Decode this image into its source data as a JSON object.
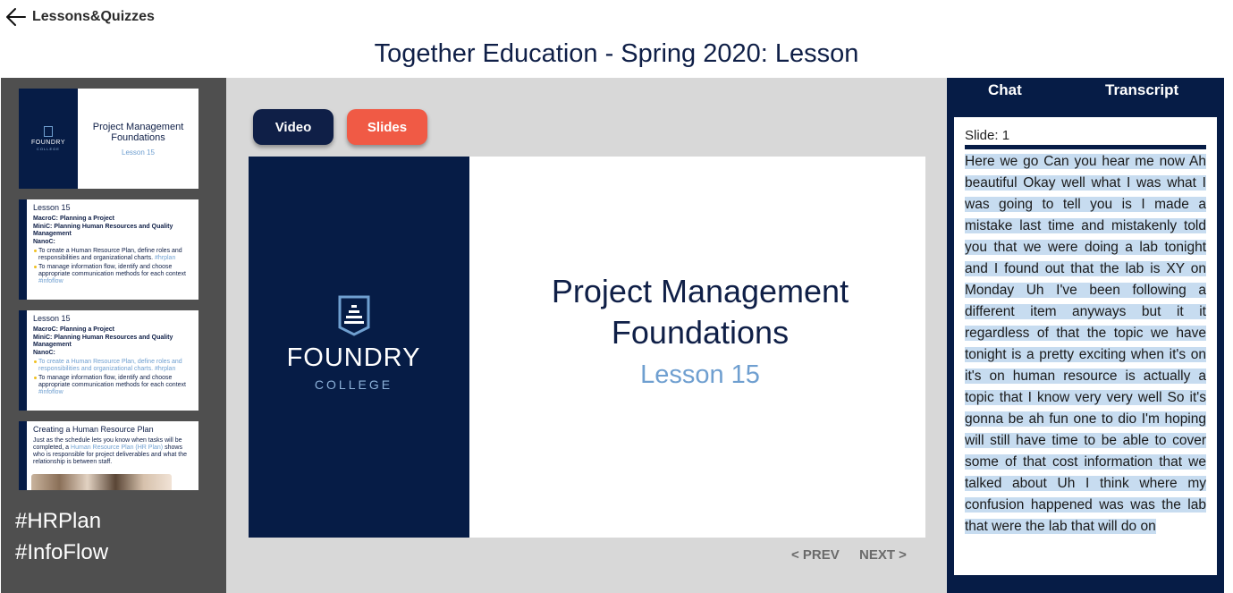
{
  "header": {
    "back_label": "Lessons&Quizzes",
    "page_title": "Together Education - Spring 2020: Lesson"
  },
  "sidebar": {
    "thumbnails": [
      {
        "brand": "FOUNDRY",
        "college": "COLLEGE",
        "title": "Project Management Foundations",
        "subtitle": "Lesson 15"
      },
      {
        "heading": "Lesson 15",
        "macro": "MacroC: Planning a Project",
        "mini": "MiniC: Planning Human Resources and Quality Management",
        "nano": "NanoC:",
        "bullet1": "To create a Human Resource Plan, define roles and responsibilities and organizational charts.",
        "bullet1_tag": "#hrplan",
        "bullet2": "To manage information flow, identify and choose appropriate communication methods for each context",
        "bullet2_tag": "#infoflow"
      },
      {
        "heading": "Lesson 15",
        "macro": "MacroC: Planning a Project",
        "mini": "MiniC: Planning Human Resources and Quality Management",
        "nano": "NanoC:",
        "bullet1": "To create a Human Resource Plan, define roles and responsibilities and organizational charts.",
        "bullet1_tag": "#hrplan",
        "bullet2": "To manage information flow, identify and choose appropriate communication methods for each context",
        "bullet2_tag": "#infoflow"
      },
      {
        "heading": "Creating a Human Resource Plan",
        "body1": "Just as the schedule lets you know when tasks will be completed, a",
        "link": "Human Resource Plan (HR Plan)",
        "body2": "shows who is responsible for project deliverables and what the relationship is between staff."
      }
    ],
    "hashtags": [
      "#HRPlan",
      "#InfoFlow"
    ]
  },
  "main": {
    "buttons": {
      "video": "Video",
      "slides": "Slides"
    },
    "slide": {
      "brand": "FOUNDRY",
      "college": "COLLEGE",
      "title": "Project Management Foundations",
      "subtitle": "Lesson 15"
    },
    "nav": {
      "prev": "< PREV",
      "next": "NEXT >"
    }
  },
  "right_panel": {
    "tabs": {
      "chat": "Chat",
      "transcript": "Transcript"
    },
    "slide_label": "Slide: 1",
    "transcript": "Here we go Can you hear me now Ah beautiful Okay well what I was what I was going to tell you is I made a mistake last time and mistakenly told you that we were doing a lab tonight and I found out that the lab is XY on Monday Uh I've been following a different item anyways but it it regardless of that the topic we have tonight is a pretty exciting when it's on it's on human resource is actually a topic that I know very very well So it's gonna be ah fun one to dio I'm hoping will still have time to be able to cover some of that cost information that we talked about Uh I think where my confusion happened was was the lab that were the lab that will do on"
  },
  "colors": {
    "navy": "#061c46",
    "title_navy": "#0f1f47",
    "accent_coral": "#f05a45",
    "light_blue": "#6f9fd0",
    "highlight": "#c7dcf0",
    "sidebar_gray": "#4f4f4f",
    "stage_gray": "#d8d8d8"
  },
  "icons": {
    "back": "arrow-left-icon",
    "logo": "foundry-logo-icon"
  }
}
